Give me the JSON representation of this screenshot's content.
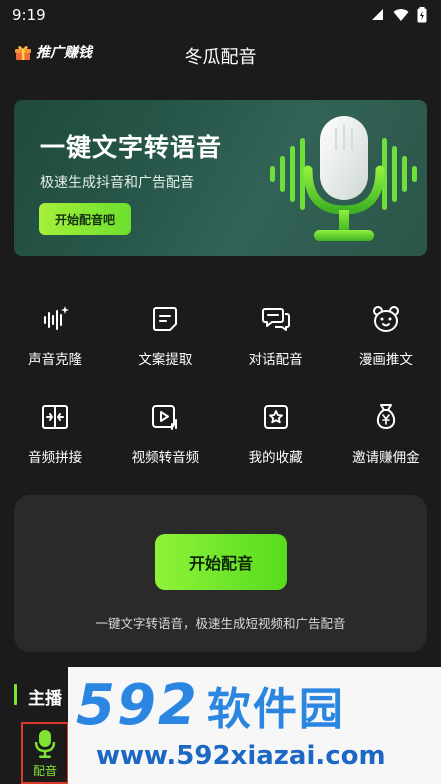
{
  "status_bar": {
    "time": "9:19"
  },
  "header": {
    "promo_label": "推广赚钱",
    "title": "冬瓜配音"
  },
  "banner": {
    "title": "一键文字转语音",
    "subtitle": "极速生成抖音和广告配音",
    "button_label": "开始配音吧"
  },
  "features": [
    {
      "label": "声音克隆",
      "icon": "voice-clone-icon"
    },
    {
      "label": "文案提取",
      "icon": "text-extract-icon"
    },
    {
      "label": "对话配音",
      "icon": "dialogue-icon"
    },
    {
      "label": "漫画推文",
      "icon": "comic-icon"
    },
    {
      "label": "音频拼接",
      "icon": "audio-splice-icon"
    },
    {
      "label": "视频转音频",
      "icon": "video-to-audio-icon"
    },
    {
      "label": "我的收藏",
      "icon": "favorites-icon"
    },
    {
      "label": "邀请赚佣金",
      "icon": "invite-icon"
    }
  ],
  "start_card": {
    "button_label": "开始配音",
    "description": "一键文字转语音，极速生成短视频和广告配音"
  },
  "section": {
    "title": "主播"
  },
  "tab_bar": {
    "dub_label": "配音"
  },
  "watermark": {
    "number": "592",
    "name": "软件园",
    "url": "www.592xiazai.com"
  },
  "colors": {
    "accent": "#7fe332",
    "background": "#1b1b1b",
    "card": "#2a2a2a"
  }
}
